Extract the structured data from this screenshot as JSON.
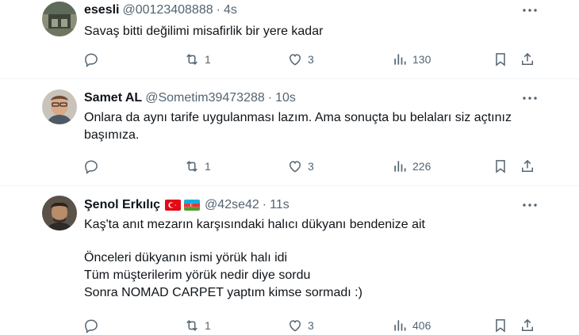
{
  "tweets": [
    {
      "name": "esesli",
      "handle": "@00123408888",
      "time": "4s",
      "text_lines": [
        "Savaş bitti değilimi misafirlik bir yere kadar"
      ],
      "retweets": "1",
      "likes": "3",
      "views": "130"
    },
    {
      "name": "Samet AL",
      "handle": "@Sometim39473288",
      "time": "10s",
      "text_lines": [
        "Onlara da aynı tarife uygulanması lazım. Ama sonuçta bu belaları siz açtınız",
        "başımıza."
      ],
      "retweets": "1",
      "likes": "3",
      "views": "226"
    },
    {
      "name": "Şenol Erkılıç",
      "handle": "@42se42",
      "time": "11s",
      "flags": [
        "turkey-flag",
        "azerbaijan-flag"
      ],
      "text_lines": [
        "Kaş'ta anıt mezarın karşısındaki halıcı dükyanı bendenize ait",
        "",
        "Önceleri dükyanın ismi yörük halı idi",
        "Tüm müşterilerim yörük nedir diye sordu",
        "Sonra NOMAD CARPET yaptım kimse sormadı :)"
      ],
      "retweets": "1",
      "likes": "3",
      "views": "406"
    }
  ],
  "separator": "·",
  "colors": {
    "text": "#0f1419",
    "secondary": "#536471",
    "divider": "#eff3f4"
  }
}
